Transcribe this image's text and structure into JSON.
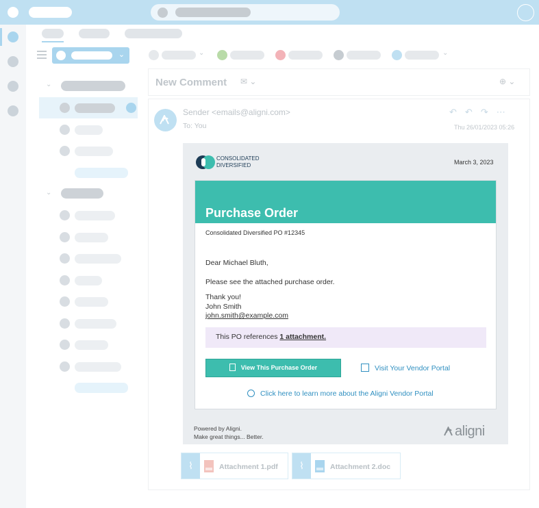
{
  "reading_pane": {
    "title": "New Comment",
    "sender": "Sender <emails@aligni.com>",
    "to": "To:  You",
    "datetime": "Thu 26/01/2023 05:26"
  },
  "email": {
    "logo_line1": "CONSOLIDATED",
    "logo_line2": "DIVERSIFIED",
    "date": "March 3, 2023",
    "heading": "Purchase Order",
    "po_reference": "Consolidated Diversified PO #12345",
    "greeting": "Dear Michael Bluth,",
    "message": "Please see the attached purchase order.",
    "closing": "Thank you!",
    "signer_name": "John Smith",
    "signer_email": "john.smith@example.com",
    "attachment_note_prefix": "This PO references",
    "attachment_note_link": "1 attachment.",
    "view_button": "View This Purchase Order",
    "vendor_portal_link": "Visit Your Vendor Portal",
    "learn_more_link": "Click here to learn more about the Aligni Vendor Portal",
    "powered_by": "Powered by Aligni.",
    "tagline": "Make great things... Better.",
    "brand": "aligni"
  },
  "attachments": [
    {
      "name": "Attachment 1.pdf",
      "icon": "pdf-file-icon",
      "color": "#f3b3ad"
    },
    {
      "name": "Attachment 2.doc",
      "icon": "doc-file-icon",
      "color": "#a9d5ee"
    }
  ],
  "colors": {
    "accent": "#3dbdae",
    "topbar": "#bfe0f2",
    "link": "#2f8fc0",
    "attachment_note_bg": "#f0e9f8"
  }
}
